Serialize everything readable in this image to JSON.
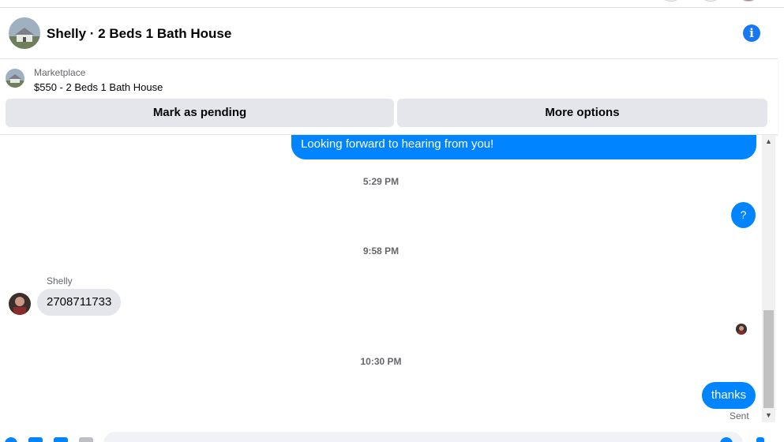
{
  "header": {
    "title": "Shelly · 2 Beds 1 Bath House",
    "info_icon": "i"
  },
  "listing": {
    "source": "Marketplace",
    "item": "$550 - 2 Beds 1 Bath House",
    "buttons": {
      "mark_pending": "Mark as pending",
      "more_options": "More options"
    }
  },
  "messages": {
    "outgoing_1": "Looking forward to hearing from you!",
    "time_1": "5:29 PM",
    "outgoing_2": "?",
    "time_2": "9:58 PM",
    "sender_name": "Shelly",
    "incoming_1": "2708711733",
    "time_3": "10:30 PM",
    "outgoing_3": "thanks",
    "status": "Sent"
  },
  "scrollbar": {
    "up_arrow": "▲",
    "down_arrow": "▼"
  },
  "colors": {
    "accent": "#0084ff",
    "info": "#1877f2",
    "button_bg": "#e4e6eb",
    "muted_text": "#65676b"
  }
}
